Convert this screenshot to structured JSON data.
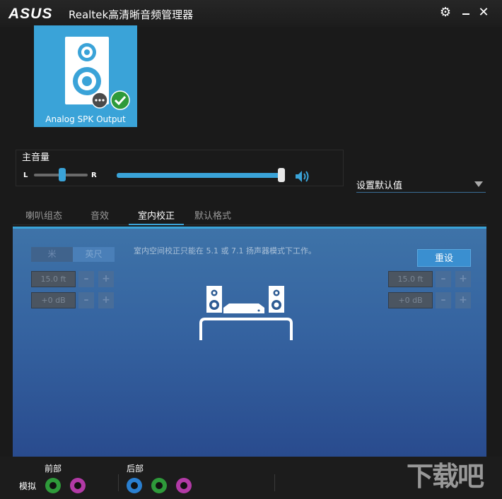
{
  "titlebar": {
    "logo": "ASUS",
    "title": "Realtek高清晰音频管理器"
  },
  "device": {
    "label": "Analog SPK Output"
  },
  "volume": {
    "label": "主音量",
    "left": "L",
    "right": "R",
    "balance_fraction": 0.5,
    "level_fraction": 0.99
  },
  "default_dropdown": {
    "label": "设置默认值"
  },
  "tabs": [
    {
      "label": "喇叭组态"
    },
    {
      "label": "音效"
    },
    {
      "label": "室内校正"
    },
    {
      "label": "默认格式"
    }
  ],
  "room": {
    "unit_meter": "米",
    "unit_foot": "英尺",
    "message": "室内空间校正只能在 5.1 或 7.1 扬声器模式下工作。",
    "reset_label": "重设",
    "left_distance": "15.0 ft",
    "left_gain": "+0 dB",
    "right_distance": "15.0 ft",
    "right_gain": "+0 dB",
    "minus": "–",
    "plus": "+"
  },
  "bottom": {
    "front_label": "前部",
    "rear_label": "后部",
    "analog_label": "模拟"
  },
  "colors": {
    "accent": "#3aa3d8",
    "jack_green": "#2e9a3a",
    "jack_pink": "#b23aa6",
    "jack_blue": "#2a7fd0"
  },
  "watermark": "下载吧"
}
